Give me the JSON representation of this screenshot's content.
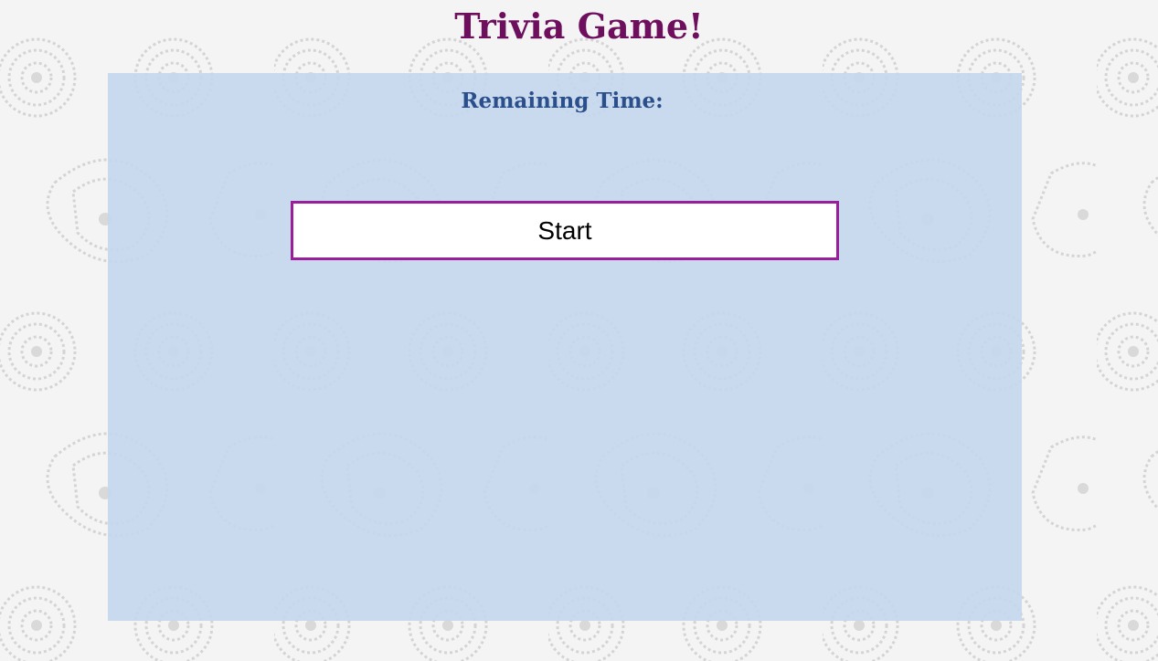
{
  "page": {
    "title": "Trivia Game!"
  },
  "game": {
    "timer_label": "Remaining Time:",
    "timer_value": "",
    "start_label": "Start"
  },
  "colors": {
    "title": "#6e0f5e",
    "timer": "#2a4f8a",
    "panel": "#c5d6ed",
    "button_border": "#9a1d9a",
    "background": "#f4f4f4",
    "pattern": "#d6d6d6"
  },
  "background_icon": "paisley-pattern"
}
